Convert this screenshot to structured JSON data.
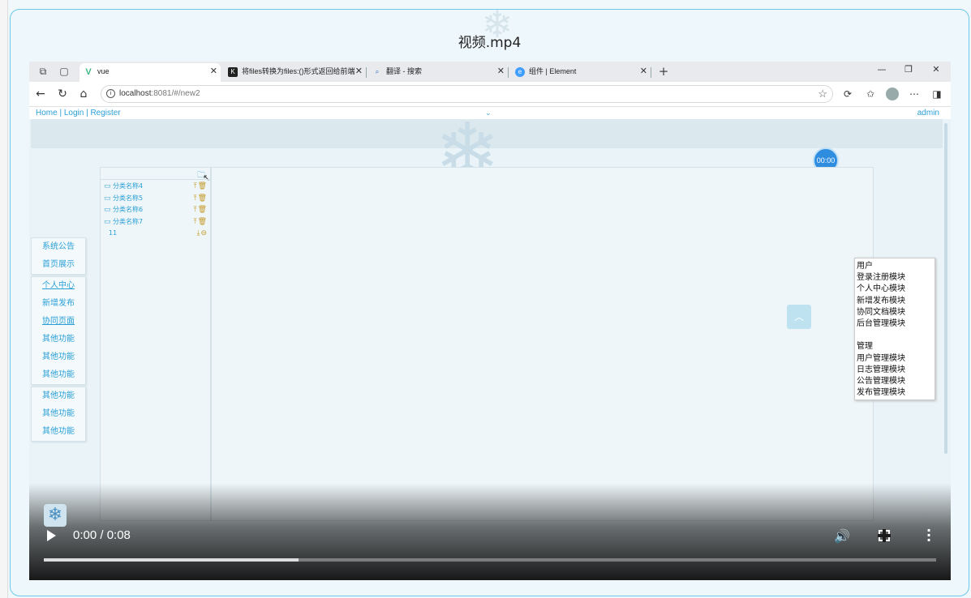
{
  "frame": {
    "title": "视频.mp4"
  },
  "browser": {
    "tabs": [
      {
        "label": "vue",
        "active": true,
        "favicon": "vue-icon"
      },
      {
        "label": "将files转换为files:()形式返回给前端",
        "active": false,
        "favicon": "k-icon"
      },
      {
        "label": "翻译 - 搜索",
        "active": false,
        "favicon": "search-icon"
      },
      {
        "label": "组件 | Element",
        "active": false,
        "favicon": "element-icon"
      }
    ],
    "url_host": "localhost",
    "url_path": ":8081/#/new2"
  },
  "page": {
    "nav_links": "Home | Login | Register",
    "user": "admin",
    "timer": "00:00",
    "sidebar_groups": [
      [
        "系统公告",
        "首页展示"
      ],
      [
        "个人中心",
        "新增发布",
        "协同页面",
        "其他功能",
        "其他功能",
        "其他功能"
      ],
      [
        "其他功能",
        "其他功能",
        "其他功能"
      ]
    ],
    "tree": [
      {
        "name": "分类名称4",
        "type": "folder",
        "actions": "⤒🗑"
      },
      {
        "name": "分类名称5",
        "type": "folder",
        "actions": "⤒🗑"
      },
      {
        "name": "分类名称6",
        "type": "folder",
        "actions": "⤒🗑"
      },
      {
        "name": "分类名称7",
        "type": "folder",
        "actions": "⤒🗑"
      },
      {
        "name": "11",
        "type": "file",
        "actions": "⤓⊖"
      }
    ],
    "notes": [
      "用户",
      "登录注册模块",
      "个人中心模块",
      "新增发布模块",
      "协同文档模块",
      "后台管理模块",
      "",
      "管理",
      "用户管理模块",
      "日志管理模块",
      "公告管理模块",
      "发布管理模块"
    ]
  },
  "video": {
    "time": "0:00 / 0:08",
    "progress": 0.285
  }
}
